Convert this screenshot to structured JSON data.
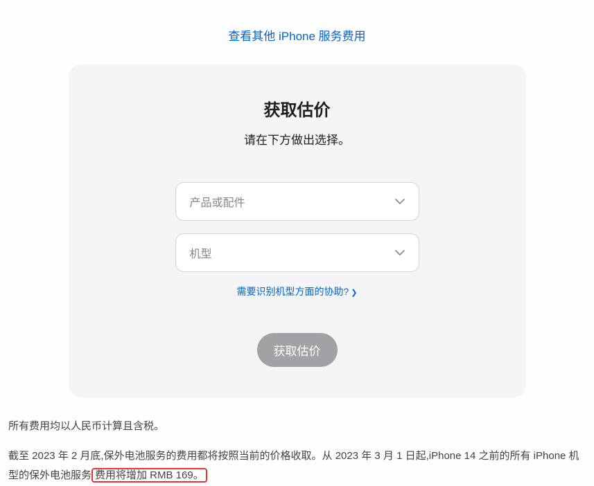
{
  "topLink": "查看其他 iPhone 服务费用",
  "card": {
    "title": "获取估价",
    "subtitle": "请在下方做出选择。",
    "select1Placeholder": "产品或配件",
    "select2Placeholder": "机型",
    "helpLink": "需要识别机型方面的协助?",
    "submitLabel": "获取估价"
  },
  "footer": {
    "line1": "所有费用均以人民币计算且含税。",
    "line2Part1": "截至 2023 年 2 月底,保外电池服务的费用都将按照当前的价格收取。从 2023 年 3 月 1 日起,iPhone 14 之前的所有 iPhone 机型的保外电池服务",
    "line2Highlight": "费用将增加 RMB 169。"
  }
}
